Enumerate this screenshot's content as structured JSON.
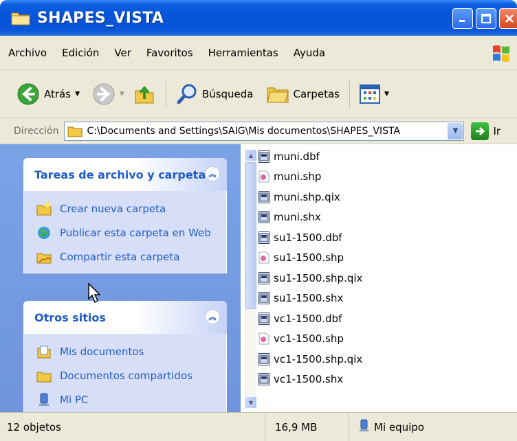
{
  "window": {
    "title": "SHAPES_VISTA"
  },
  "menu": [
    "Archivo",
    "Edición",
    "Ver",
    "Favoritos",
    "Herramientas",
    "Ayuda"
  ],
  "toolbar": {
    "back_label": "Atrás",
    "search_label": "Búsqueda",
    "folders_label": "Carpetas"
  },
  "address": {
    "label": "Dirección",
    "path": "C:\\Documents and Settings\\SAIG\\Mis documentos\\SHAPES_VISTA",
    "go_label": "Ir"
  },
  "tasks_panel": {
    "title": "Tareas de archivo y carpeta",
    "items": [
      "Crear nueva carpeta",
      "Publicar esta carpeta en Web",
      "Compartir esta carpeta"
    ]
  },
  "other_places": {
    "title": "Otros sitios",
    "items": [
      "Mis documentos",
      "Documentos compartidos",
      "Mi PC"
    ]
  },
  "files": [
    {
      "name": "muni.dbf",
      "icon": "dbf-file-icon"
    },
    {
      "name": "muni.shp",
      "icon": "shp-file-icon"
    },
    {
      "name": "muni.shp.qix",
      "icon": "qix-file-icon"
    },
    {
      "name": "muni.shx",
      "icon": "shx-file-icon"
    },
    {
      "name": "su1-1500.dbf",
      "icon": "dbf-file-icon"
    },
    {
      "name": "su1-1500.shp",
      "icon": "shp-file-icon"
    },
    {
      "name": "su1-1500.shp.qix",
      "icon": "qix-file-icon"
    },
    {
      "name": "su1-1500.shx",
      "icon": "shx-file-icon"
    },
    {
      "name": "vc1-1500.dbf",
      "icon": "dbf-file-icon"
    },
    {
      "name": "vc1-1500.shp",
      "icon": "shp-file-icon"
    },
    {
      "name": "vc1-1500.shp.qix",
      "icon": "qix-file-icon"
    },
    {
      "name": "vc1-1500.shx",
      "icon": "shx-file-icon"
    }
  ],
  "status": {
    "objects": "12 objetos",
    "size": "16,9 MB",
    "zone": "Mi equipo"
  },
  "colors": {
    "titlebar": "#0553d6",
    "task_link": "#215dc6",
    "left_pane": "#7ba2e7",
    "chrome": "#ece9d8"
  }
}
